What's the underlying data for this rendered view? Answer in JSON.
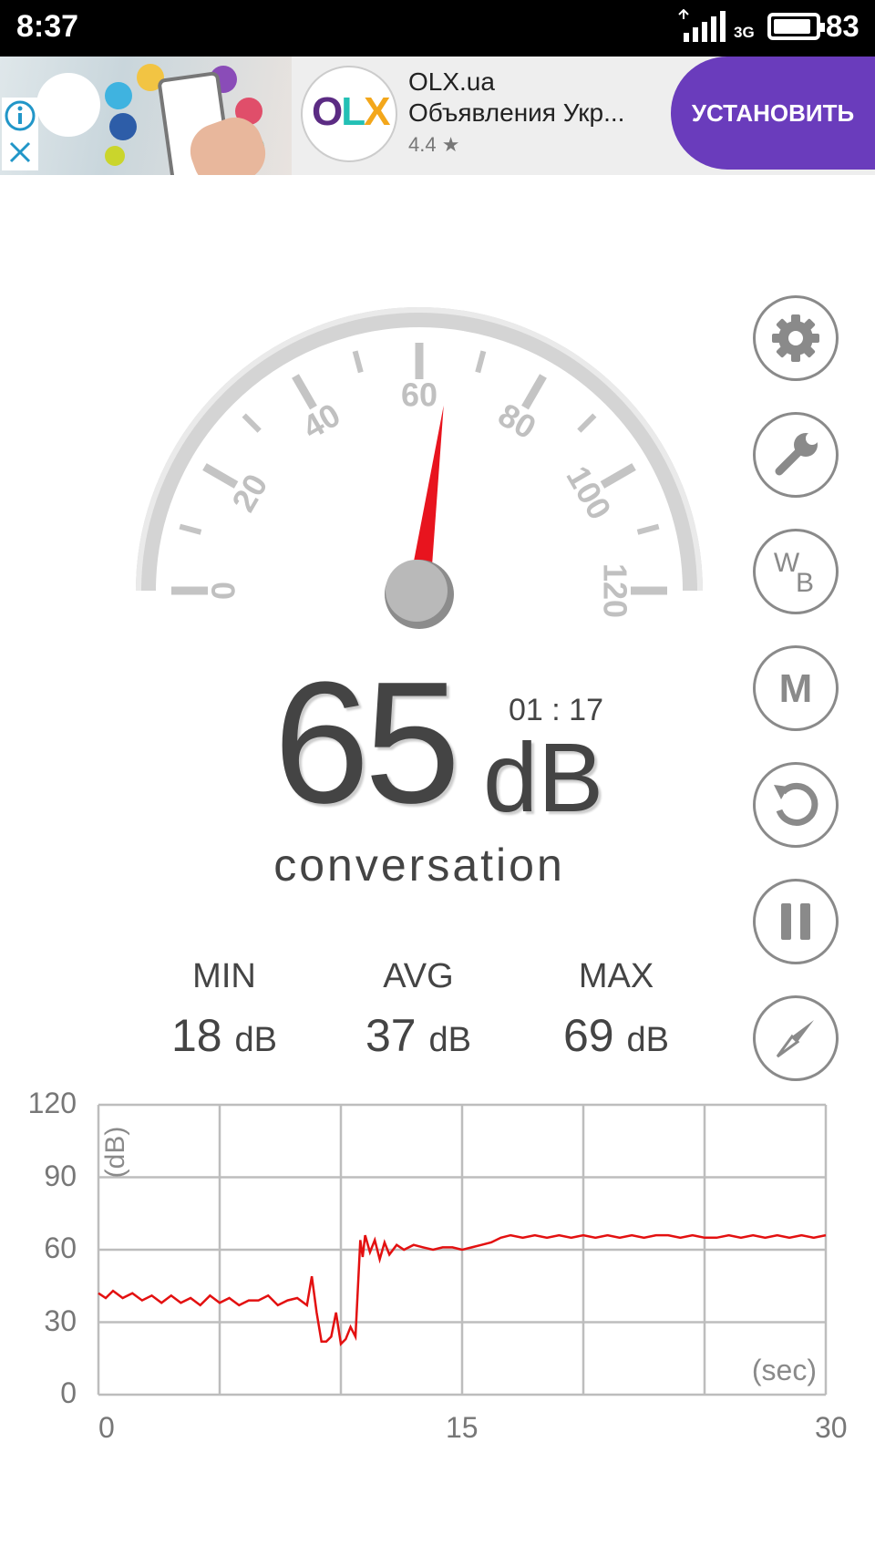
{
  "status_bar": {
    "time": "8:37",
    "network": "3G",
    "battery": "83"
  },
  "ad": {
    "brand": "OLX.ua",
    "subtitle": "Объявления Укр...",
    "rating": "4.4 ★",
    "cta": "УСТАНОВИТЬ",
    "logo": "OLX"
  },
  "gauge": {
    "min": 0,
    "max": 120,
    "ticks": [
      "0",
      "20",
      "40",
      "60",
      "80",
      "100",
      "120"
    ],
    "needle_value": 65
  },
  "reading": {
    "value": "65",
    "unit": "dB",
    "timer": "01 : 17",
    "description": "conversation"
  },
  "stats": [
    {
      "label": "MIN",
      "value": "18",
      "unit": "dB"
    },
    {
      "label": "AVG",
      "value": "37",
      "unit": "dB"
    },
    {
      "label": "MAX",
      "value": "69",
      "unit": "dB"
    }
  ],
  "side_buttons": [
    {
      "name": "settings-button",
      "icon": "gear-icon"
    },
    {
      "name": "calibrate-button",
      "icon": "wrench-icon"
    },
    {
      "name": "weighting-button",
      "icon": "wb-icon",
      "text_top": "W",
      "text_bottom": "B"
    },
    {
      "name": "mode-button",
      "icon": "m-icon",
      "text": "M"
    },
    {
      "name": "reset-button",
      "icon": "refresh-icon"
    },
    {
      "name": "pause-button",
      "icon": "pause-icon"
    },
    {
      "name": "compass-button",
      "icon": "compass-icon"
    }
  ],
  "chart_data": {
    "type": "line",
    "yticks": [
      "120",
      "90",
      "60",
      "30",
      "0"
    ],
    "xticks": [
      "0",
      "15",
      "30"
    ],
    "ylabel": "(dB)",
    "xlabel": "(sec)",
    "xlim": [
      0,
      30
    ],
    "ylim": [
      0,
      120
    ],
    "grid": true,
    "color": "#e31010",
    "series": [
      {
        "x": [
          0,
          0.3,
          0.6,
          1,
          1.4,
          1.8,
          2.2,
          2.6,
          3,
          3.4,
          3.8,
          4.2,
          4.6,
          5,
          5.4,
          5.8,
          6.2,
          6.6,
          7,
          7.4,
          7.8,
          8.2,
          8.6,
          8.8,
          9,
          9.2,
          9.4,
          9.6,
          9.8,
          10,
          10.2,
          10.4,
          10.6,
          10.8,
          10.9,
          11,
          11.2,
          11.4,
          11.6,
          11.8,
          12,
          12.3,
          12.6,
          13,
          13.4,
          13.8,
          14.2,
          14.6,
          15,
          15.4,
          15.8,
          16.2,
          16.6,
          17,
          17.5,
          18,
          18.5,
          19,
          19.5,
          20,
          20.5,
          21,
          21.5,
          22,
          22.5,
          23,
          23.5,
          24,
          24.5,
          25,
          25.5,
          26,
          26.5,
          27,
          27.5,
          28,
          28.5,
          29,
          29.5,
          30
        ],
        "y": [
          42,
          40,
          43,
          40,
          42,
          39,
          41,
          38,
          41,
          38,
          40,
          37,
          41,
          38,
          40,
          37,
          39,
          39,
          41,
          37,
          39,
          40,
          37,
          49,
          34,
          22,
          22,
          24,
          34,
          21,
          23,
          28,
          24,
          64,
          57,
          66,
          59,
          64,
          56,
          63,
          58,
          62,
          60,
          62,
          61,
          60,
          61,
          61,
          60,
          61,
          62,
          63,
          65,
          66,
          65,
          66,
          65,
          66,
          65,
          66,
          65,
          66,
          65,
          66,
          65,
          66,
          66,
          65,
          66,
          65,
          65,
          66,
          65,
          66,
          65,
          66,
          65,
          66,
          65,
          66
        ]
      }
    ]
  }
}
